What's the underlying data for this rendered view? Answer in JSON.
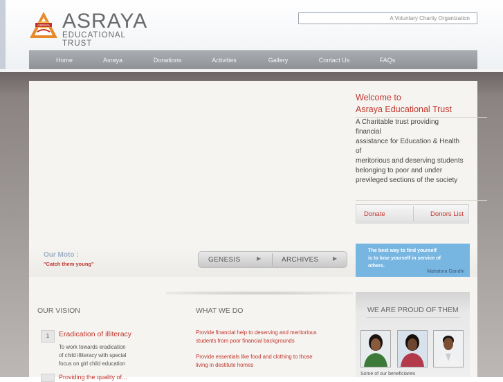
{
  "header": {
    "logo_title": "ASRAYA",
    "logo_subtitle": "EDUCATIONAL TRUST",
    "logo_mark_text": "ASRAYA",
    "tagline": "A Voluntary Charity Organization"
  },
  "nav": {
    "items": [
      {
        "label": "Home"
      },
      {
        "label": "Asraya"
      },
      {
        "label": "Donations"
      },
      {
        "label": "Activities"
      },
      {
        "label": "Gallery"
      },
      {
        "label": "Contact Us"
      },
      {
        "label": "FAQs"
      }
    ]
  },
  "welcome": {
    "title_line1": "Welcome to",
    "title_line2": "Asraya Educational Trust",
    "text_lines": [
      "A Charitable trust providing",
      "financial",
      "assistance for Education & Health",
      "of",
      "meritorious and deserving students",
      "belonging to poor and under",
      "previleged sections of the society"
    ],
    "donate_label": "Donate",
    "donors_label": "Donors List"
  },
  "moto": {
    "title": "Our Moto :",
    "subtitle": "\"Catch them young\""
  },
  "genesis_archives": {
    "genesis_label": "GENESIS",
    "archives_label": "ARCHIVES",
    "arrow": "▶"
  },
  "quote": {
    "line1": "The best way to find yourself",
    "line2": "is to lose yourself in service of",
    "line3": "others.",
    "author": "Mahatma Gandhi"
  },
  "vision": {
    "heading": "OUR VISION",
    "item1_number": "1",
    "item1_title": "Eradication of illiteracy",
    "item1_lines": [
      "To work towards eradication",
      "of child illiteracy with special",
      "focus on girl child education"
    ],
    "item2_peek": "Providing the quality of..."
  },
  "what_we_do": {
    "heading": "WHAT WE DO",
    "item1_lines": [
      "Provide financial help to deserving and meritorious",
      "students from poor financial backgrounds"
    ],
    "item2_lines": [
      "Provide essentials like food and clothing to those",
      "living in destitute homes"
    ]
  },
  "proud": {
    "heading": "WE ARE PROUD OF THEM",
    "caption": "Some of our beneficiaries",
    "photo_count": 3
  },
  "colors": {
    "accent_red": "#c2352c",
    "nav_gray": "#999c9f",
    "quote_blue": "#78b6e2",
    "body_brown": "#8a8382"
  }
}
